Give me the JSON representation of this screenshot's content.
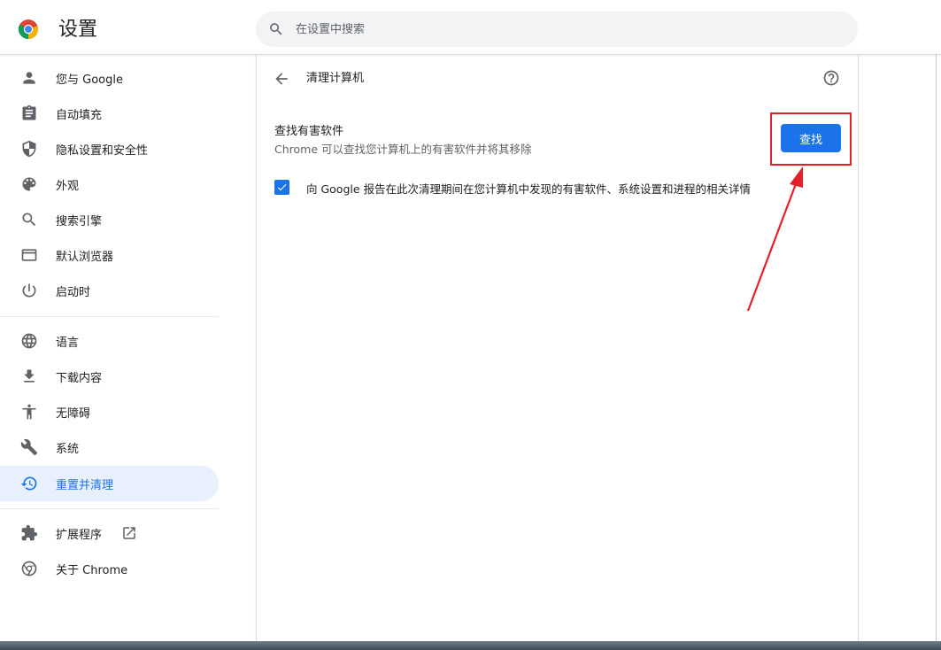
{
  "header": {
    "title": "设置",
    "search_placeholder": "在设置中搜索"
  },
  "sidebar": {
    "items": [
      {
        "label": "您与 Google",
        "icon": "person-icon"
      },
      {
        "label": "自动填充",
        "icon": "clipboard-icon"
      },
      {
        "label": "隐私设置和安全性",
        "icon": "shield-icon"
      },
      {
        "label": "外观",
        "icon": "palette-icon"
      },
      {
        "label": "搜索引擎",
        "icon": "search-icon"
      },
      {
        "label": "默认浏览器",
        "icon": "browser-window-icon"
      },
      {
        "label": "启动时",
        "icon": "power-icon"
      },
      {
        "label": "语言",
        "icon": "globe-icon"
      },
      {
        "label": "下载内容",
        "icon": "download-icon"
      },
      {
        "label": "无障碍",
        "icon": "accessibility-icon"
      },
      {
        "label": "系统",
        "icon": "wrench-icon"
      },
      {
        "label": "重置并清理",
        "icon": "history-icon",
        "active": true
      },
      {
        "label": "扩展程序",
        "icon": "puzzle-icon"
      },
      {
        "label": "关于 Chrome",
        "icon": "chrome-icon"
      }
    ]
  },
  "main": {
    "page_title": "清理计算机",
    "section_title": "查找有害软件",
    "section_desc": "Chrome 可以查找您计算机上的有害软件并将其移除",
    "find_button": "查找",
    "checkbox_label": "向 Google 报告在此次清理期间在您计算机中发现的有害软件、系统设置和进程的相关详情",
    "checkbox_checked": true
  },
  "colors": {
    "accent": "#1a73e8",
    "active_bg": "#e8f0fe",
    "annotation": "#e4212b"
  }
}
